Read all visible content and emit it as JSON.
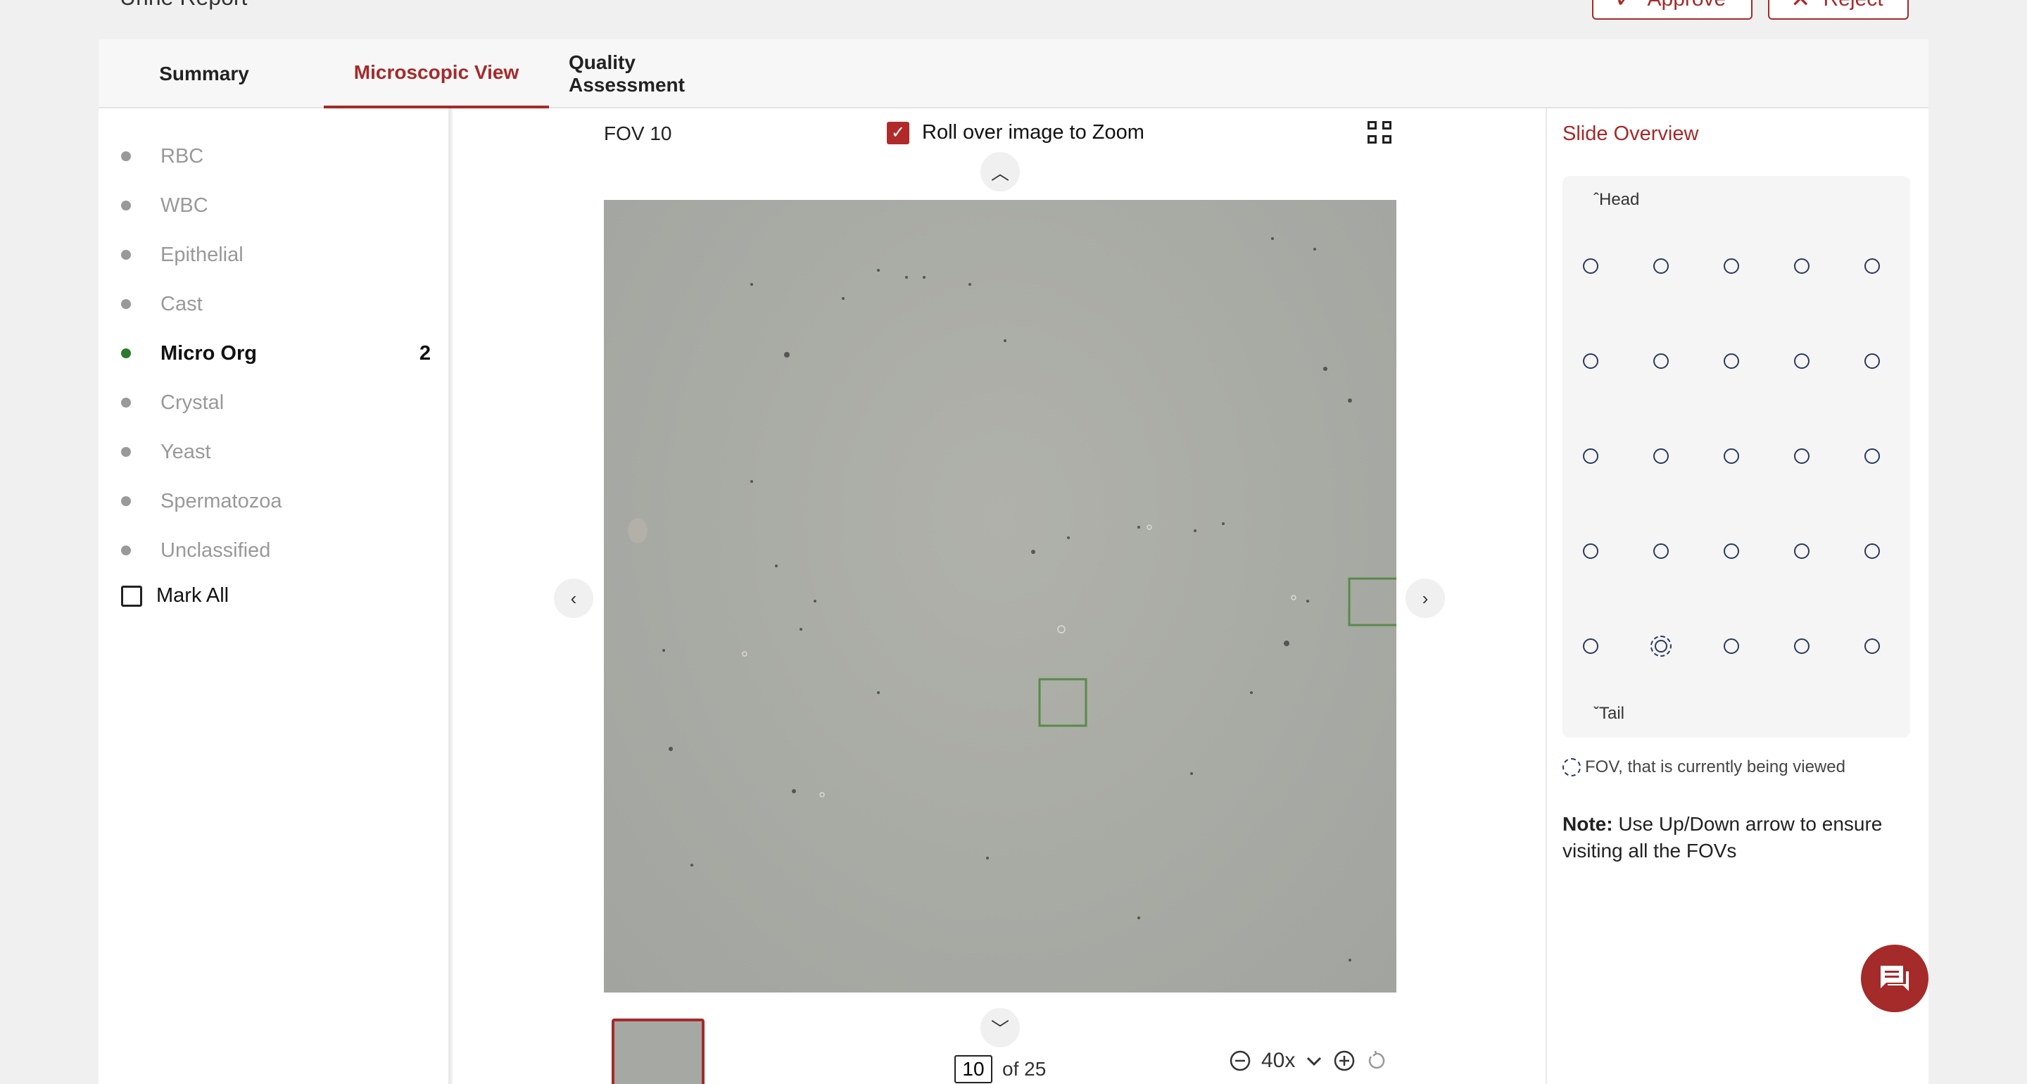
{
  "header": {
    "title": "Urine Report",
    "approve_label": "Approve",
    "reject_label": "Reject"
  },
  "tabs": [
    {
      "label": "Summary"
    },
    {
      "label": "Microscopic View",
      "active": true
    },
    {
      "label": "Quality Assessment"
    }
  ],
  "categories": [
    {
      "label": "RBC",
      "count": ""
    },
    {
      "label": "WBC",
      "count": ""
    },
    {
      "label": "Epithelial",
      "count": ""
    },
    {
      "label": "Cast",
      "count": ""
    },
    {
      "label": "Micro Org",
      "count": "2",
      "active": true
    },
    {
      "label": "Crystal",
      "count": ""
    },
    {
      "label": "Yeast",
      "count": ""
    },
    {
      "label": "Spermatozoa",
      "count": ""
    },
    {
      "label": "Unclassified",
      "count": ""
    }
  ],
  "mark_all_label": "Mark All",
  "viewer": {
    "fov_label": "FOV 10",
    "zoom_toggle_label": "Roll over image to Zoom",
    "zoom_toggle_checked": true,
    "page_current": "10",
    "page_total_label": "of 25",
    "magnification": "40x"
  },
  "slide_overview": {
    "title": "Slide Overview",
    "head_label": "Head",
    "tail_label": "Tail",
    "grid_rows": 5,
    "grid_cols": 5,
    "current_fov_index": 21,
    "legend_text": "FOV, that is currently being viewed",
    "note_bold": "Note:",
    "note_text": " Use Up/Down arrow to ensure visiting all the FOVs"
  },
  "colors": {
    "accent": "#a52a2a",
    "active_dot": "#2d7a2d",
    "detection_box": "#5a8a4a"
  }
}
